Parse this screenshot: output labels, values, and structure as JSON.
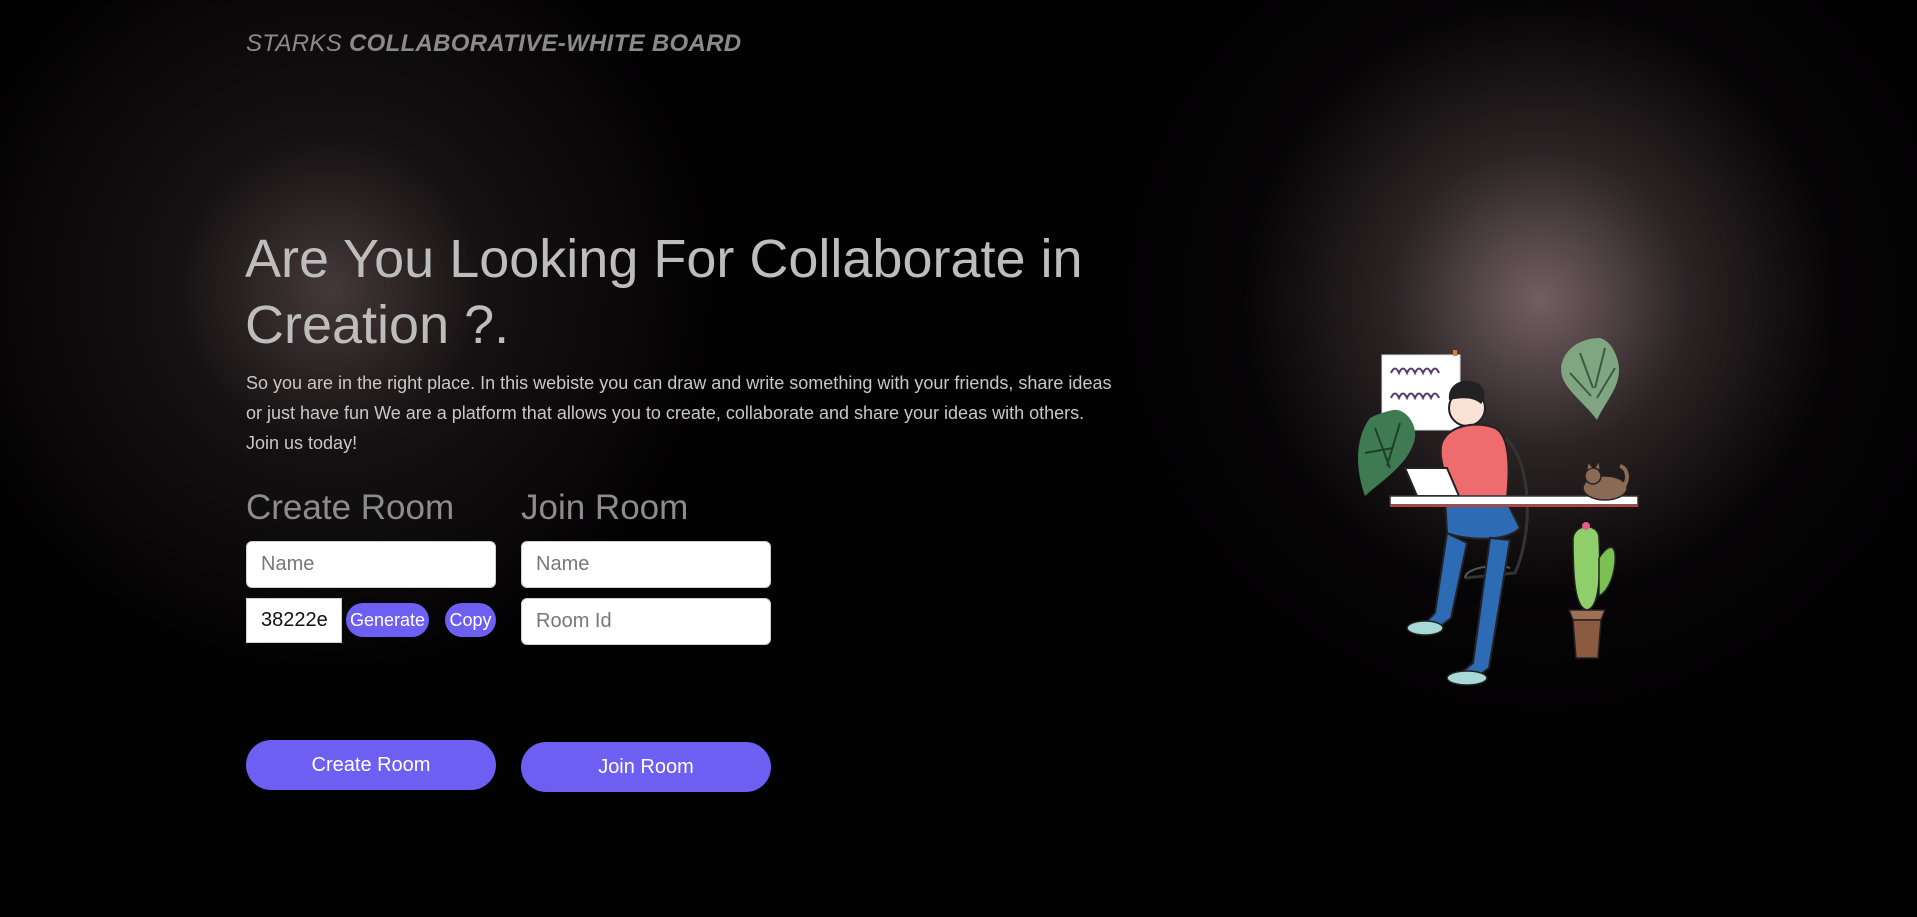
{
  "brand": {
    "prefix": "STARKS ",
    "name": "COLLABORATIVE-WHITE BOARD"
  },
  "hero": {
    "title": "Are You Looking For Collaborate in Creation ?.",
    "description": "So you are in the right place. In this webiste you can draw and write something with your friends, share ideas or just have fun We are a platform that allows you to create, collaborate and share your ideas with others. Join us today!"
  },
  "create_room": {
    "heading": "Create Room",
    "name_placeholder": "Name",
    "room_id_value": "38222e",
    "generate_label": "Generate",
    "copy_label": "Copy",
    "submit_label": "Create Room"
  },
  "join_room": {
    "heading": "Join Room",
    "name_placeholder": "Name",
    "room_id_placeholder": "Room Id",
    "submit_label": "Join Room"
  },
  "colors": {
    "accent": "#6c5ff2",
    "background": "#000000",
    "heading_text": "#bdbdbd",
    "muted_text": "#8c8c8c"
  },
  "illustration": {
    "icon": "person-at-desk-illustration"
  }
}
